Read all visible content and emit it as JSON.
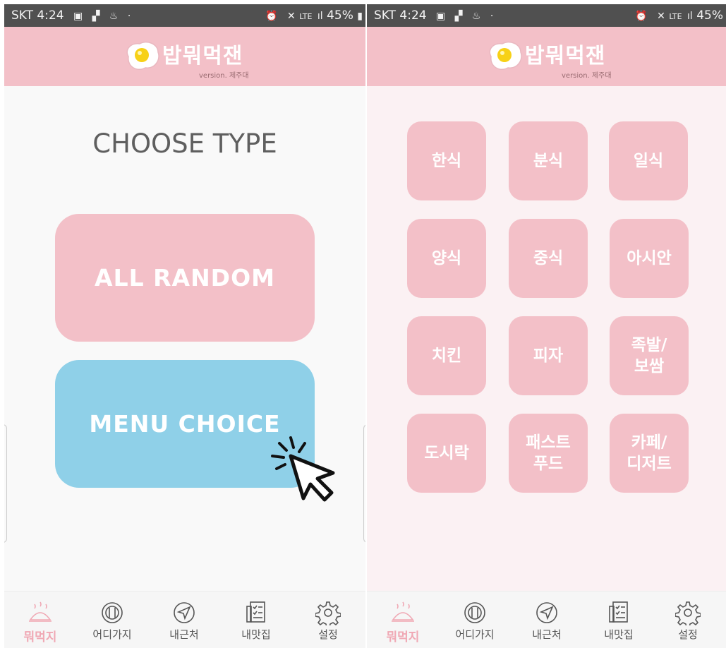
{
  "status_bar": {
    "carrier": "SKT",
    "time": "4:24",
    "network": "LTE",
    "battery": "45%"
  },
  "header": {
    "app_title": "밥뭐먹잰",
    "version": "version. 제주대"
  },
  "left_screen": {
    "title": "CHOOSE TYPE",
    "all_random_label": "ALL RANDOM",
    "menu_choice_label": "MENU CHOICE"
  },
  "right_screen": {
    "categories": [
      "한식",
      "분식",
      "일식",
      "양식",
      "중식",
      "아시안",
      "치킨",
      "피자",
      "족발/\n보쌈",
      "도시락",
      "패스트\n푸드",
      "카페/\n디저트"
    ]
  },
  "tabs": [
    {
      "label": "뭐먹지",
      "icon": "food-cloche-icon",
      "active": true
    },
    {
      "label": "어디가지",
      "icon": "cutlery-plate-icon",
      "active": false
    },
    {
      "label": "내근처",
      "icon": "navigation-arrow-icon",
      "active": false
    },
    {
      "label": "내맛집",
      "icon": "checklist-icon",
      "active": false
    },
    {
      "label": "설정",
      "icon": "gear-icon",
      "active": false
    }
  ],
  "colors": {
    "header_pink": "#f3c0c8",
    "tile_pink": "#f3c0c8",
    "menu_choice_blue": "#8fd0e8",
    "active_tab": "#f0a8b4",
    "status_bar": "#505050"
  }
}
